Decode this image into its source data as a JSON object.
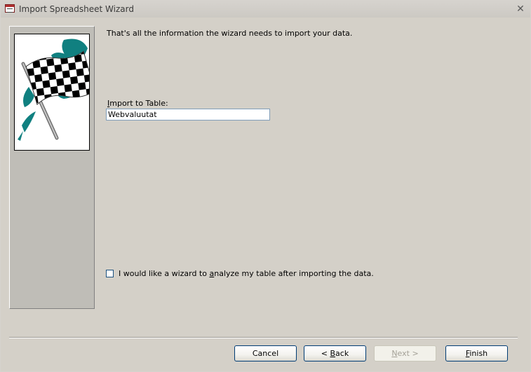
{
  "window": {
    "title": "Import Spreadsheet Wizard",
    "close_glyph": "✕"
  },
  "main": {
    "intro": "That's all the information the wizard needs to import your data.",
    "import_label_prefix": "I",
    "import_label_rest": "mport to Table:",
    "table_name_value": "Webvaluutat",
    "analyze_checkbox_label_before": "I would like a wizard to ",
    "analyze_checkbox_label_mnemonic": "a",
    "analyze_checkbox_label_after": "nalyze my table after importing the data.",
    "analyze_checked": false
  },
  "buttons": {
    "cancel": "Cancel",
    "back_prefix": "< ",
    "back_mnemonic": "B",
    "back_rest": "ack",
    "next_prefix": "",
    "next_mnemonic": "N",
    "next_rest": "ext >",
    "finish_mnemonic": "F",
    "finish_rest": "inish"
  },
  "colors": {
    "dialog_bg": "#d4d0c8",
    "sidebar_bg": "#bfbdb7",
    "flag_accent": "#108080"
  },
  "icons": {
    "app": "access-table-icon",
    "close": "close-icon",
    "illustration": "checkered-flag-icon",
    "checkbox": "checkbox-icon"
  }
}
